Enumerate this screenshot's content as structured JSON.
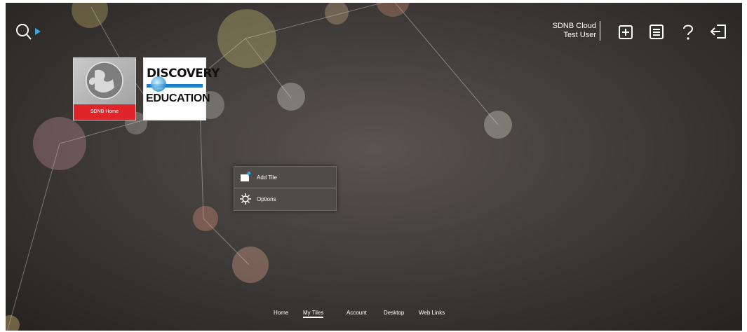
{
  "header": {
    "account_line1": "SDNB Cloud",
    "account_line2": "Test User",
    "icons": [
      "add-tile-icon",
      "notes-icon",
      "help-icon",
      "logout-icon"
    ]
  },
  "tiles": [
    {
      "label": "SDNB Home",
      "icon": "globe-icon"
    },
    {
      "logo_line1": "DISCOVERY",
      "logo_line2": "EDUCATION"
    }
  ],
  "context_menu": {
    "add_tile": "Add Tile",
    "options": "Options"
  },
  "bottom_nav": {
    "home": "Home",
    "my_tiles": "My Tiles",
    "account": "Account",
    "desktop": "Desktop",
    "web_links": "Web Links",
    "active": "My Tiles"
  },
  "colors": {
    "accent_blue": "#3aa3e0",
    "tile_label_red": "#e0252a",
    "discovery_blue": "#1e7fc8"
  }
}
